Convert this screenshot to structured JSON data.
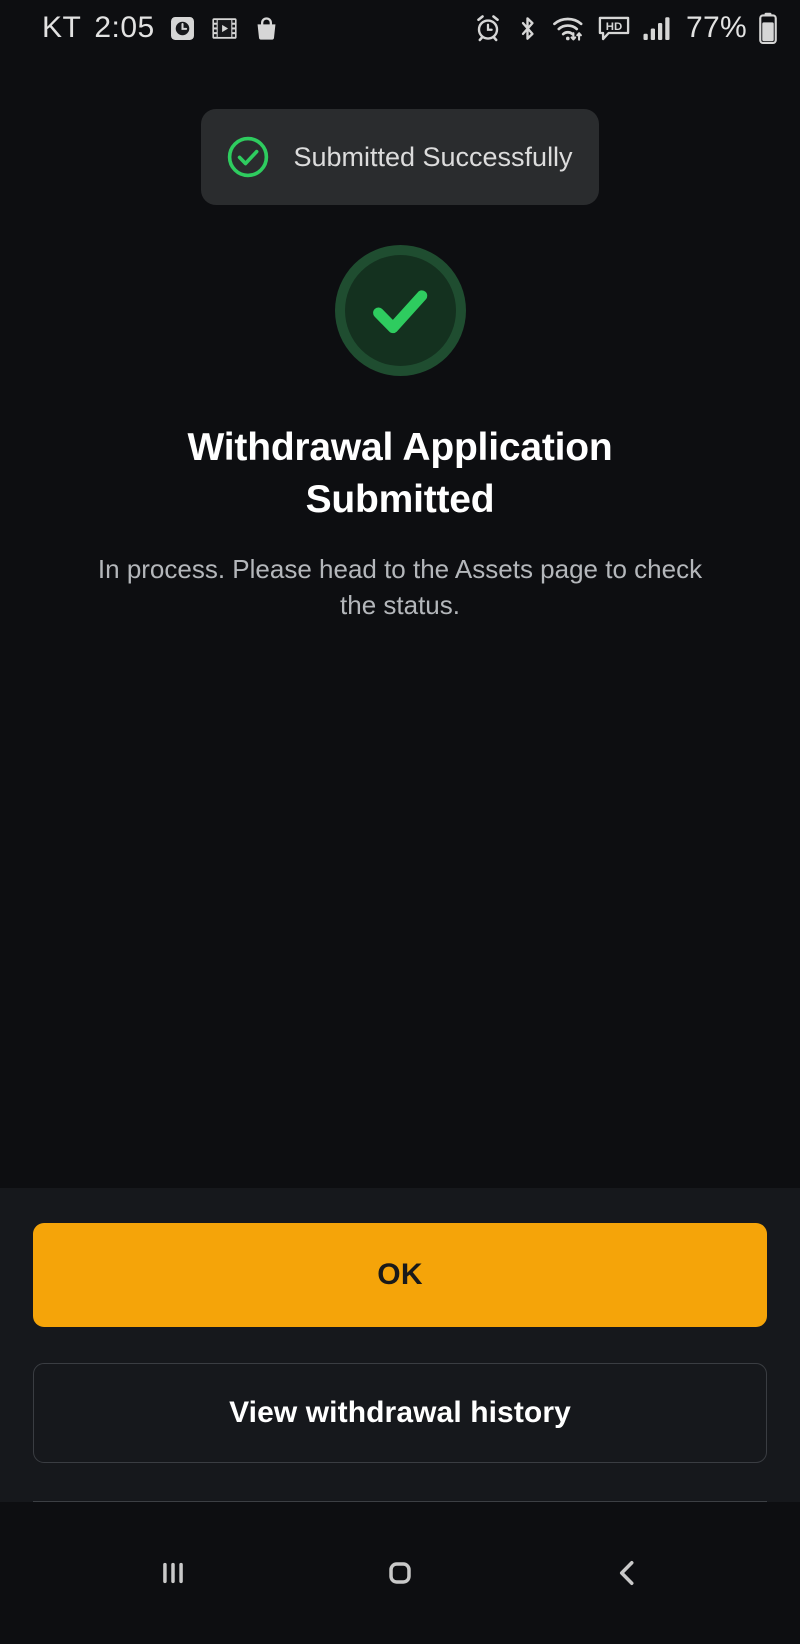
{
  "status_bar": {
    "carrier": "KT",
    "time": "2:05",
    "battery_percent": "77%",
    "left_icons": [
      "clock-badge-icon",
      "film-strip-icon",
      "shopping-bag-icon"
    ],
    "right_icons": [
      "alarm-icon",
      "bluetooth-icon",
      "wifi-data-icon",
      "hd-call-icon",
      "cellular-signal-icon",
      "battery-icon"
    ]
  },
  "toast": {
    "message": "Submitted Successfully",
    "icon": "circle-check-icon",
    "icon_color": "#2ecc5f",
    "background": "#2a2c2e"
  },
  "hero": {
    "icon": "success-check-icon",
    "ring_color": "#1f4d30",
    "inner_color": "#14311f",
    "check_color": "#2ecc5f",
    "title": "Withdrawal Application Submitted",
    "subtitle": "In process. Please head to the Assets page to check the status."
  },
  "actions": {
    "primary_label": "OK",
    "primary_color": "#f5a409",
    "secondary_label": "View withdrawal history",
    "panel_background": "#16181c"
  },
  "nav_bar": {
    "recents_icon": "recent-apps-icon",
    "home_icon": "home-icon",
    "back_icon": "back-chevron-icon"
  },
  "theme": {
    "background": "#0d0e11",
    "accent": "#f5a409",
    "success": "#2ecc5f",
    "text_primary": "#ffffff",
    "text_secondary": "#b4b7bb"
  }
}
